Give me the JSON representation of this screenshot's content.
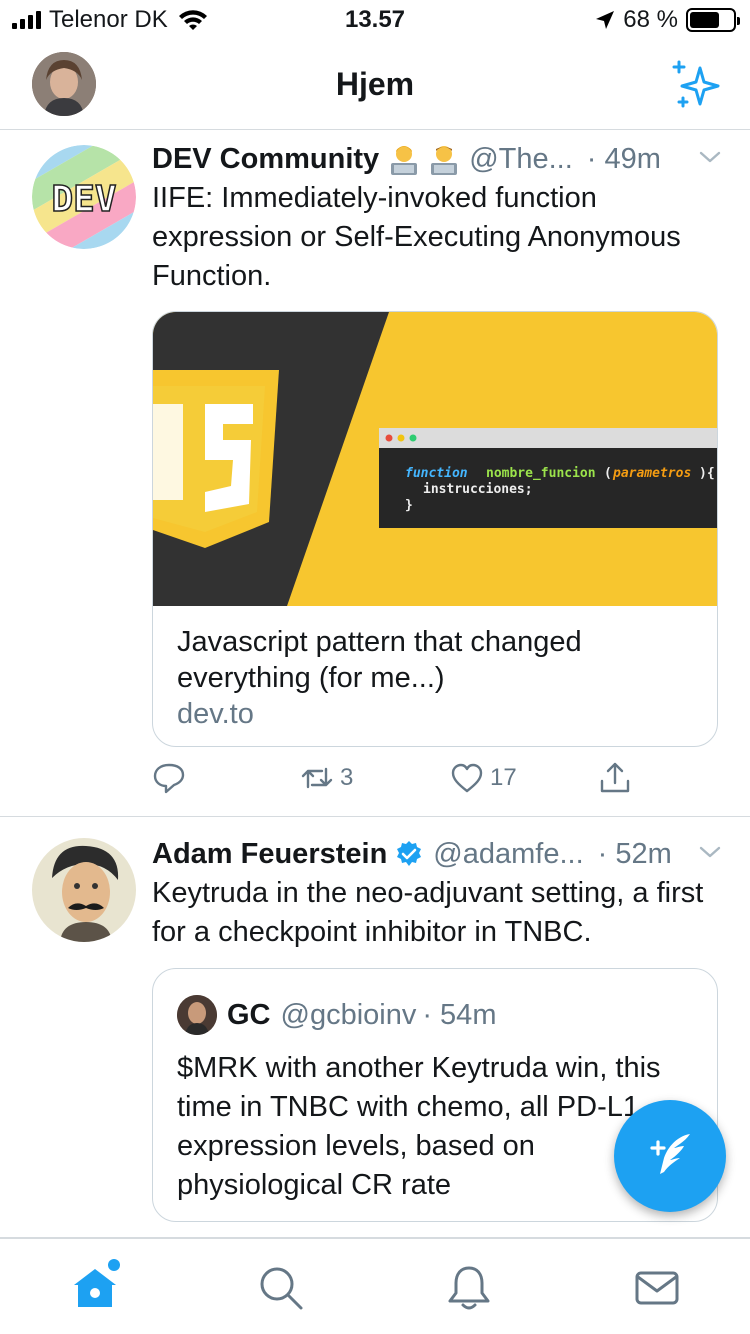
{
  "status_bar": {
    "carrier": "Telenor DK",
    "time": "13.57",
    "battery": "68 %",
    "battery_level": 0.68
  },
  "header": {
    "title": "Hjem"
  },
  "tweets": [
    {
      "name": "DEV Community",
      "handle": "@The...",
      "time": "· 49m",
      "text": "IIFE: Immediately-invoked function expression or Self-Executing Anonymous Function.",
      "avatar_text": "DEV",
      "card": {
        "code_line1_keyword": "function",
        "code_line1_name": "nombre_funcion",
        "code_line1_params": "parametros",
        "code_line2": "instrucciones;",
        "title": "Javascript pattern that changed everything (for me...)",
        "domain": "dev.to"
      },
      "actions": {
        "retweets": "3",
        "likes": "17"
      }
    },
    {
      "name": "Adam Feuerstein",
      "handle": "@adamfe...",
      "time": "· 52m",
      "text": "Keytruda in the neo-adjuvant setting, a first for a checkpoint inhibitor in TNBC.",
      "quote": {
        "name": "GC",
        "handle": "@gcbioinv",
        "time": "· 54m",
        "text": "$MRK with another Keytruda win, this time in TNBC with chemo, all PD-L1 expression levels, based on physiological CR rate"
      }
    }
  ],
  "colors": {
    "accent": "#1da1f2",
    "text_primary": "#14171a",
    "text_secondary": "#657786",
    "divider": "#d6dbdf",
    "js_yellow": "#f7c62f",
    "dark": "#323232"
  },
  "icons": {
    "header": [
      "sparkle-icon"
    ],
    "tweet_actions": [
      "reply-icon",
      "retweet-icon",
      "like-icon",
      "share-icon"
    ],
    "tabbar": [
      "home-icon",
      "search-icon",
      "notifications-icon",
      "messages-icon"
    ],
    "fab": "compose-icon"
  }
}
